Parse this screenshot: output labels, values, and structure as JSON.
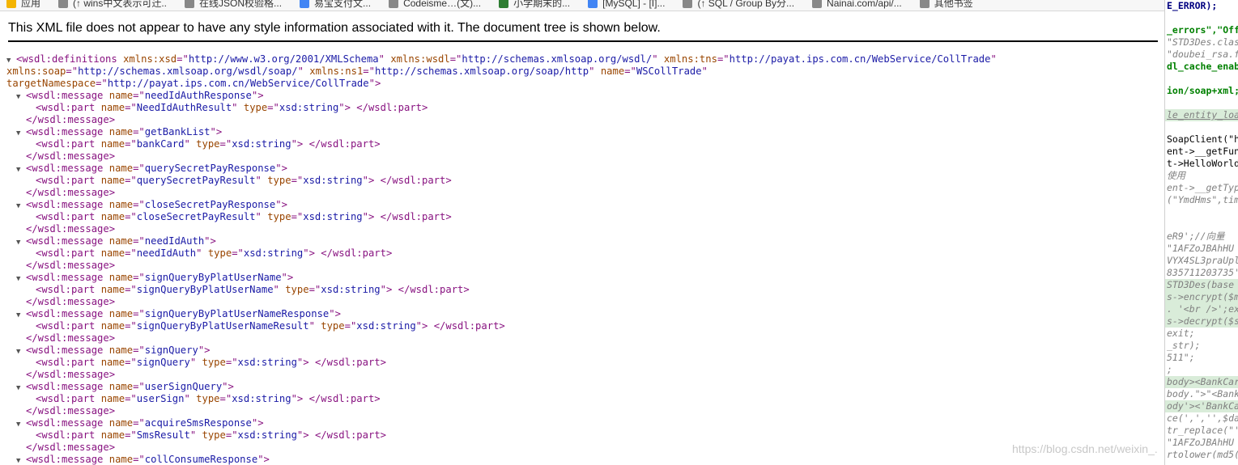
{
  "bookmarks": [
    {
      "label": "应用",
      "color": "#f4b400"
    },
    {
      "label": "(↑ wins中文表示可迁..",
      "color": "#888888"
    },
    {
      "label": "在线JSON校验格...",
      "color": "#888888"
    },
    {
      "label": "易宝支付文...",
      "color": "#4285f4"
    },
    {
      "label": "Codeisme…(文)...",
      "color": "#888888"
    },
    {
      "label": "小学期末的...",
      "color": "#2e7d32"
    },
    {
      "label": "[MySQL] - [I]...",
      "color": "#4285f4"
    },
    {
      "label": "(↑ SQL / Group By分...",
      "color": "#888888"
    },
    {
      "label": "Nainai.com/api/...",
      "color": "#888888"
    },
    {
      "label": "其他书签",
      "color": "#888888"
    }
  ],
  "xml_notice": "This XML file does not appear to have any style information associated with it. The document tree is shown below.",
  "root_open": {
    "tag": "wsdl:definitions",
    "attrs_line1": [
      {
        "n": "xmlns:xsd",
        "v": "http://www.w3.org/2001/XMLSchema"
      },
      {
        "n": "xmlns:wsdl",
        "v": "http://schemas.xmlsoap.org/wsdl/"
      },
      {
        "n": "xmlns:tns",
        "v": "http://payat.ips.com.cn/WebService/CollTrade"
      }
    ],
    "attrs_line2": [
      {
        "n": "xmlns:soap",
        "v": "http://schemas.xmlsoap.org/wsdl/soap/"
      },
      {
        "n": "xmlns:ns1",
        "v": "http://schemas.xmlsoap.org/soap/http"
      },
      {
        "n": "name",
        "v": "WSCollTrade"
      }
    ],
    "attrs_line3": [
      {
        "n": "targetNamespace",
        "v": "http://payat.ips.com.cn/WebService/CollTrade"
      }
    ]
  },
  "messages": [
    {
      "name": "needIdAuthResponse",
      "part_name": "NeedIdAuthResult",
      "part_type": "xsd:string"
    },
    {
      "name": "getBankList",
      "part_name": "bankCard",
      "part_type": "xsd:string"
    },
    {
      "name": "querySecretPayResponse",
      "part_name": "querySecretPayResult",
      "part_type": "xsd:string"
    },
    {
      "name": "closeSecretPayResponse",
      "part_name": "closeSecretPayResult",
      "part_type": "xsd:string"
    },
    {
      "name": "needIdAuth",
      "part_name": "needIdAuth",
      "part_type": "xsd:string"
    },
    {
      "name": "signQueryByPlatUserName",
      "part_name": "signQueryByPlatUserName",
      "part_type": "xsd:string"
    },
    {
      "name": "signQueryByPlatUserNameResponse",
      "part_name": "signQueryByPlatUserNameResult",
      "part_type": "xsd:string"
    },
    {
      "name": "signQuery",
      "part_name": "signQuery",
      "part_type": "xsd:string"
    },
    {
      "name": "userSignQuery",
      "part_name": "userSign",
      "part_type": "xsd:string"
    },
    {
      "name": "acquireSmsResponse",
      "part_name": "SmsResult",
      "part_type": "xsd:string"
    }
  ],
  "last_message_name": "collConsumeResponse",
  "code_lines": [
    {
      "t": "E_ERROR);",
      "c": "kw"
    },
    {
      "t": "",
      "c": ""
    },
    {
      "t": "_errors\",\"Off",
      "c": "str"
    },
    {
      "t": "\"STD3Des.clas",
      "c": "gr"
    },
    {
      "t": "\"doubei_rsa.f",
      "c": "gr"
    },
    {
      "t": "dl_cache_enab",
      "c": "str"
    },
    {
      "t": "",
      "c": ""
    },
    {
      "t": "ion/soap+xml;",
      "c": "str"
    },
    {
      "t": "",
      "c": ""
    },
    {
      "t": "le_entity_loa",
      "c": "gr hl und"
    },
    {
      "t": "",
      "c": ""
    },
    {
      "t": "SoapClient(\"h",
      "c": "bk"
    },
    {
      "t": "ent->__getFun",
      "c": "bk"
    },
    {
      "t": "t->HelloWorld",
      "c": "bk"
    },
    {
      "t": "使用",
      "c": "gr"
    },
    {
      "t": "ent->__getTyp",
      "c": "gr"
    },
    {
      "t": "(\"YmdHms\",tim",
      "c": "gr"
    },
    {
      "t": "",
      "c": ""
    },
    {
      "t": "",
      "c": ""
    },
    {
      "t": "eR9';//向量",
      "c": "gr"
    },
    {
      "t": "\"1AFZoJBAhHU",
      "c": "gr"
    },
    {
      "t": "VYX4SL3praUpl",
      "c": "gr"
    },
    {
      "t": "835711203735'",
      "c": "gr"
    },
    {
      "t": "STD3Des(base",
      "c": "gr hl"
    },
    {
      "t": "s->encrypt($m",
      "c": "gr hl"
    },
    {
      "t": ". '<br />';ex",
      "c": "gr hl"
    },
    {
      "t": "s->decrypt($s",
      "c": "gr hl"
    },
    {
      "t": "exit;",
      "c": "gr"
    },
    {
      "t": "_str);",
      "c": "gr"
    },
    {
      "t": "511\";",
      "c": "gr"
    },
    {
      "t": ";",
      "c": "gr"
    },
    {
      "t": "body><BankCar",
      "c": "gr hl"
    },
    {
      "t": "body.\">\"<Bank",
      "c": "gr"
    },
    {
      "t": "ody'><'BankCa",
      "c": "gr hl"
    },
    {
      "t": "ce(',','',$da",
      "c": "gr"
    },
    {
      "t": "tr_replace(\"'",
      "c": "gr"
    },
    {
      "t": "\"1AFZoJBAhHU",
      "c": "gr"
    },
    {
      "t": "rtolower(md5(",
      "c": "gr"
    }
  ],
  "watermark": "https://blog.csdn.net/weixin_..."
}
